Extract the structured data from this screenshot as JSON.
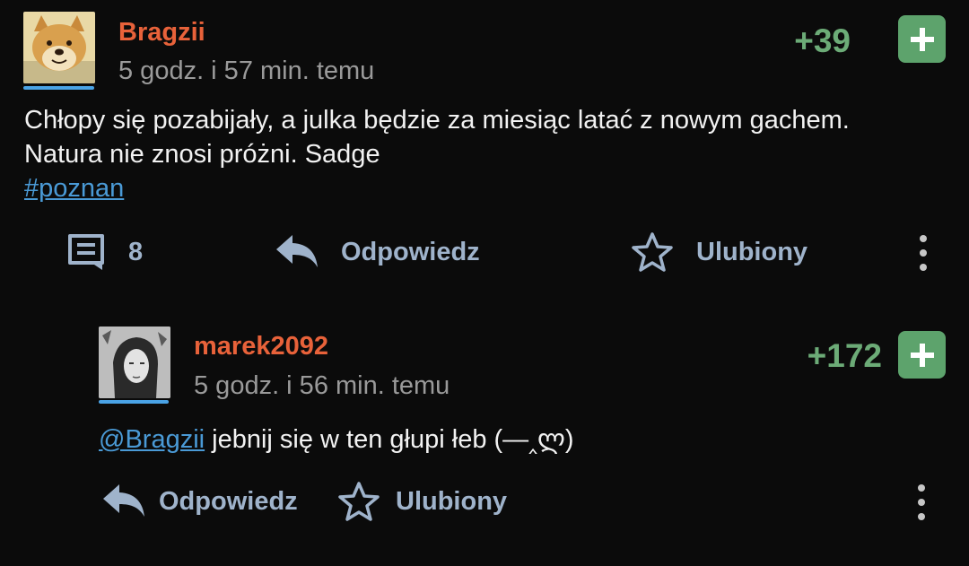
{
  "post": {
    "author": "Bragzii",
    "time": "5 godz. i 57 min. temu",
    "score": "+39",
    "text_line1": "Chłopy się pozabijały, a julka będzie za miesiąc latać z nowym gachem.",
    "text_line2": "Natura nie znosi próżni. Sadge",
    "tag": "#poznan",
    "comments_count": "8",
    "reply_label": "Odpowiedz",
    "favorite_label": "Ulubiony"
  },
  "reply": {
    "author": "marek2092",
    "time": "5 godz. i 56 min. temu",
    "score": "+172",
    "mention": "@Bragzii",
    "text": "jebnij się w ten głupi łeb (—‸ლ)",
    "reply_label": "Odpowiedz",
    "favorite_label": "Ulubiony"
  },
  "colors": {
    "background": "#0b0b0b",
    "username": "#e8623a",
    "score": "#6cab77",
    "plus_button": "#5da36c",
    "link": "#4a9ad6",
    "action": "#9fb3cb"
  },
  "icons": [
    "doge-avatar",
    "plus-icon",
    "comment-icon",
    "reply-icon",
    "star-icon",
    "more-vertical-icon",
    "user-photo-avatar"
  ]
}
